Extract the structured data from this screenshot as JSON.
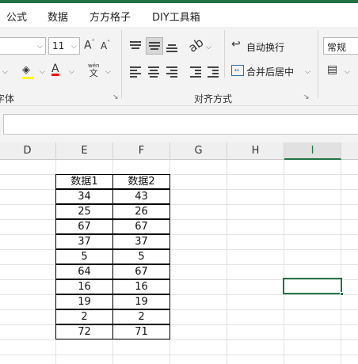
{
  "menu": {
    "tabs": [
      "公式",
      "数据",
      "方方格子",
      "DIY工具箱"
    ]
  },
  "ribbon": {
    "font_size": "11",
    "grow_font_label": "A",
    "shrink_font_label": "A",
    "wen_label": "wén",
    "wen_char": "文",
    "font_color_label": "A",
    "font_group_label": "字体",
    "wrap_text_label": "自动换行",
    "merge_center_label": "合并后居中",
    "alignment_group_label": "对齐方式",
    "number_format": "常规",
    "colors": {
      "accent": "#217346",
      "fill_yellow": "#ffff00",
      "font_red": "#ff0000"
    }
  },
  "columns": [
    "D",
    "E",
    "F",
    "G",
    "H",
    "I"
  ],
  "selected_column": "I",
  "table": {
    "headers": [
      "数据1",
      "数据2"
    ],
    "rows": [
      [
        "34",
        "43"
      ],
      [
        "25",
        "26"
      ],
      [
        "67",
        "67"
      ],
      [
        "37",
        "37"
      ],
      [
        "5",
        "5"
      ],
      [
        "64",
        "67"
      ],
      [
        "16",
        "16"
      ],
      [
        "19",
        "19"
      ],
      [
        "2",
        "2"
      ],
      [
        "72",
        "71"
      ]
    ]
  }
}
